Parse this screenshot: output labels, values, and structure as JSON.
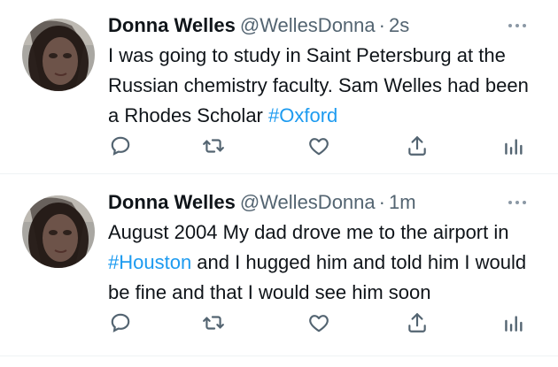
{
  "tweets": [
    {
      "author_name": "Donna Welles",
      "handle": "@WellesDonna",
      "separator": "·",
      "time": "2s",
      "text_parts": [
        {
          "text": "I was going to study in Saint Petersburg at the Russian chemistry faculty. Sam Welles had been a Rhodes Scholar ",
          "hashtag": false
        },
        {
          "text": "#Oxford",
          "hashtag": true
        }
      ]
    },
    {
      "author_name": "Donna Welles",
      "handle": "@WellesDonna",
      "separator": "·",
      "time": "1m",
      "text_parts": [
        {
          "text": "August 2004 My dad drove me to the airport in ",
          "hashtag": false
        },
        {
          "text": "#Houston",
          "hashtag": true
        },
        {
          "text": " and I hugged him and told him I would be fine and that I would see him soon",
          "hashtag": false
        }
      ]
    }
  ],
  "icons": {
    "reply": "reply-icon",
    "retweet": "retweet-icon",
    "like": "like-icon",
    "share": "share-icon",
    "analytics": "analytics-icon",
    "more": "more-icon"
  },
  "colors": {
    "text": "#0f1419",
    "secondary": "#536471",
    "hashtag": "#1d9bf0",
    "divider": "#eff3f4"
  }
}
